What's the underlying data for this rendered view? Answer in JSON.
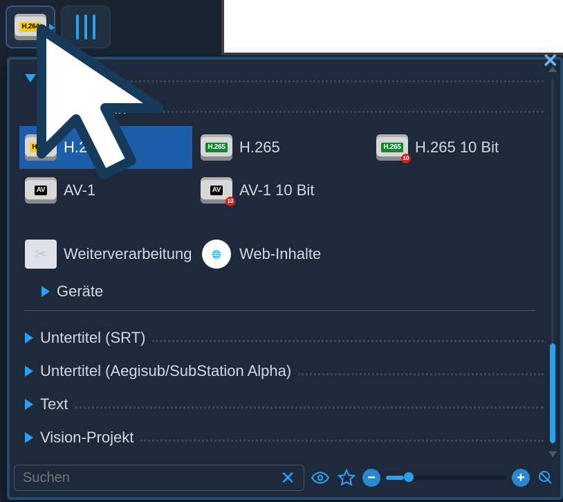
{
  "toolbar": {
    "active_codec_label": "H.264"
  },
  "panel": {
    "section_mp4": "MP4",
    "section_allgemein": "Allgemein",
    "grid_codecs": [
      {
        "key": "h264",
        "label": "H.264",
        "chip": "h264",
        "chip_text": "H.264",
        "ten": false,
        "selected": true
      },
      {
        "key": "h265",
        "label": "H.265",
        "chip": "h265",
        "chip_text": "H.265",
        "ten": false,
        "selected": false
      },
      {
        "key": "h265_10",
        "label": "H.265 10 Bit",
        "chip": "h265",
        "chip_text": "H.265",
        "ten": true,
        "selected": false
      },
      {
        "key": "av1",
        "label": "AV-1",
        "chip": "av1",
        "chip_text": "AV",
        "ten": false,
        "selected": false
      },
      {
        "key": "av1_10",
        "label": "AV-1 10 Bit",
        "chip": "av1",
        "chip_text": "AV",
        "ten": true,
        "selected": false
      }
    ],
    "row_weiter": "Weiterverarbeitung",
    "row_web": "Web-Inhalte",
    "row_geraete": "Geräte",
    "sections_collapsed": [
      "Untertitel (SRT)",
      "Untertitel (Aegisub/SubStation Alpha)",
      "Text",
      "Vision-Projekt"
    ]
  },
  "search": {
    "placeholder": "Suchen"
  }
}
